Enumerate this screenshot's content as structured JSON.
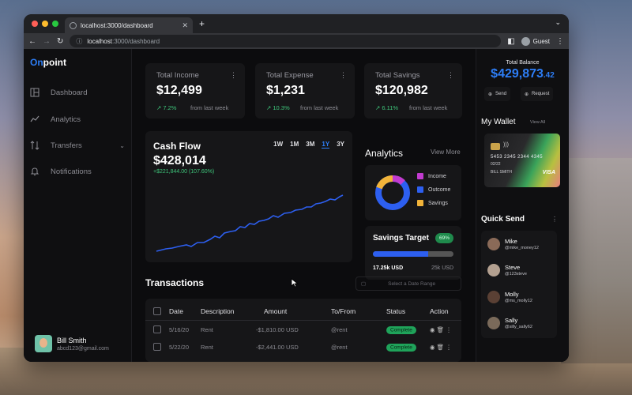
{
  "browser": {
    "tab_title": "localhost:3000/dashboard",
    "url_host": "localhost",
    "url_path": ":3000/dashboard",
    "profile": "Guest",
    "traffic_light_colors": [
      "#ff5f57",
      "#febc2e",
      "#28c840"
    ]
  },
  "brand": {
    "first": "On",
    "rest": "point",
    "accent": "#2d7ef7"
  },
  "sidebar": {
    "items": [
      {
        "label": "Dashboard",
        "icon": "layout-icon"
      },
      {
        "label": "Analytics",
        "icon": "trend-icon"
      },
      {
        "label": "Transfers",
        "icon": "transfer-icon"
      },
      {
        "label": "Notifications",
        "icon": "bell-icon"
      }
    ],
    "user": {
      "name": "Bill Smith",
      "email": "abcd123@gmail.com"
    }
  },
  "stats": [
    {
      "label": "Total Income",
      "value": "$12,499",
      "pct": "7.2%",
      "sub": "from last week"
    },
    {
      "label": "Total Expense",
      "value": "$1,231",
      "pct": "10.3%",
      "sub": "from last week"
    },
    {
      "label": "Total Savings",
      "value": "$120,982",
      "pct": "6.11%",
      "sub": "from last week"
    }
  ],
  "cashflow": {
    "title": "Cash Flow",
    "value": "$428,014",
    "change": "+$221,844.00 (107.60%)",
    "ranges": [
      "1W",
      "1M",
      "3M",
      "1Y",
      "3Y"
    ],
    "active_range": "1Y",
    "line_color": "#2d5ff0"
  },
  "analytics": {
    "title": "Analytics",
    "view_more": "View More",
    "legend": [
      {
        "label": "Income",
        "color": "#c23bd0"
      },
      {
        "label": "Outcome",
        "color": "#2d5ff0"
      },
      {
        "label": "Savings",
        "color": "#f2b43a"
      }
    ]
  },
  "savings_target": {
    "title": "Savings Target",
    "percent_label": "69%",
    "percent": 0.69,
    "current": "17.25k USD",
    "target": "25k USD"
  },
  "transactions": {
    "title": "Transactions",
    "date_placeholder": "Select a Date Range",
    "columns": [
      "Date",
      "Description",
      "Amount",
      "To/From",
      "Status",
      "Action"
    ],
    "rows": [
      {
        "date": "5/16/20",
        "desc": "Rent",
        "amount": "-$1,810.00 USD",
        "to": "@rent",
        "status": "Complete"
      },
      {
        "date": "5/22/20",
        "desc": "Rent",
        "amount": "-$2,441.00 USD",
        "to": "@rent",
        "status": "Complete"
      }
    ]
  },
  "balance": {
    "label": "Total Balance",
    "value": "$429,873",
    "cents": ".42",
    "send": "Send",
    "request": "Request"
  },
  "wallet": {
    "title": "My Wallet",
    "view_all": "View All",
    "card_number": "5453 2345 2344 4345",
    "expiry": "02/22",
    "holder": "BILL SMITH",
    "network": "VISA"
  },
  "quick_send": {
    "title": "Quick Send",
    "contacts": [
      {
        "name": "Mike",
        "handle": "@mike_money12"
      },
      {
        "name": "Steve",
        "handle": "@123steve"
      },
      {
        "name": "Molly",
        "handle": "@ms_molly12"
      },
      {
        "name": "Sally",
        "handle": "@silly_sally62"
      }
    ]
  }
}
